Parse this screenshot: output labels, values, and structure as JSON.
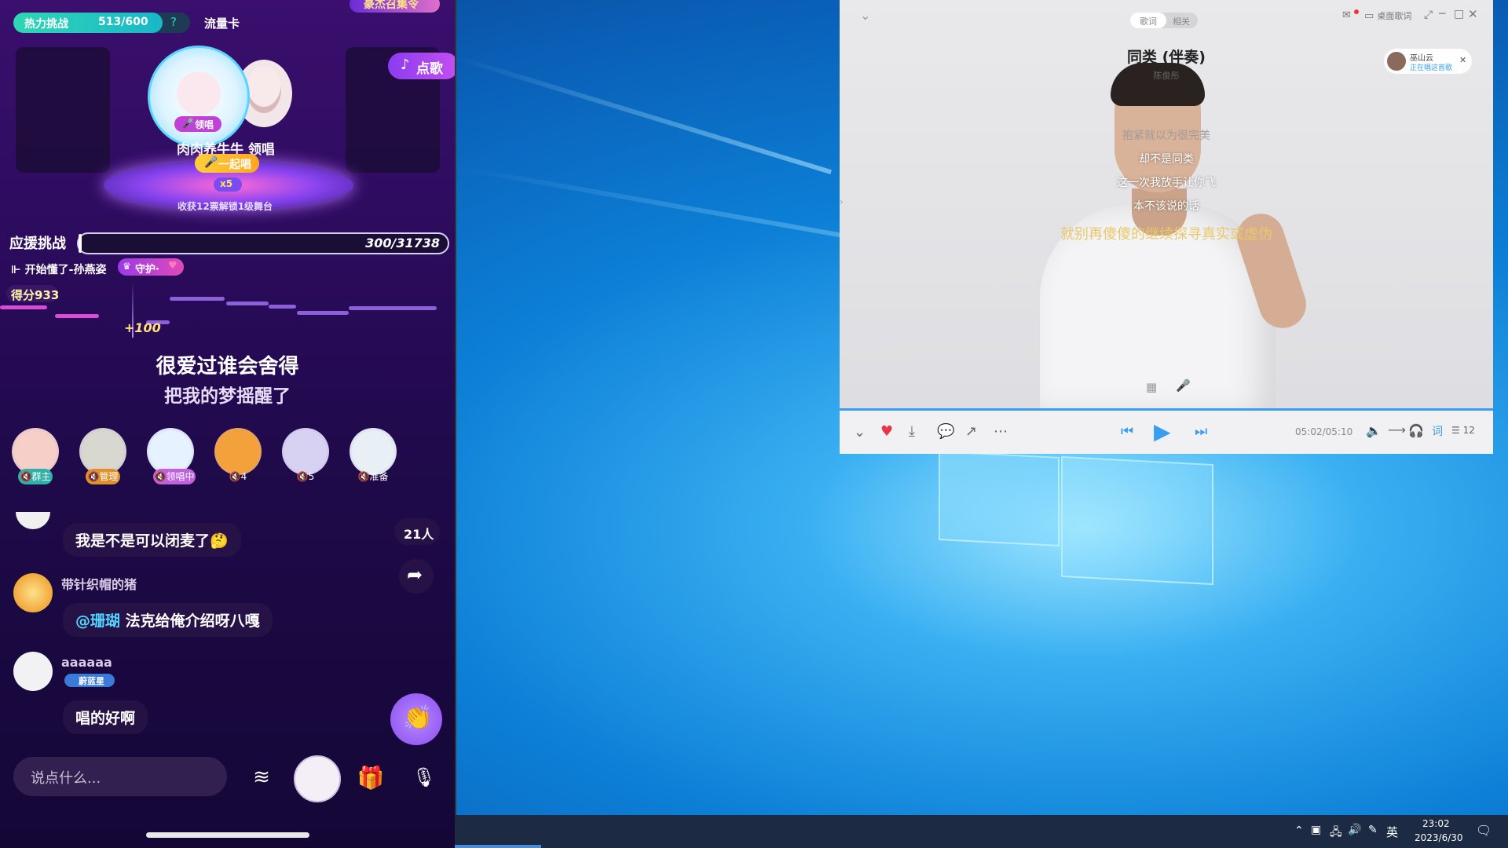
{
  "phone": {
    "challenge_label": "热力挑战",
    "challenge_progress": "513/600",
    "traffic_card": "流量卡",
    "top_banner": "豪杰召集令",
    "order_song": "点歌",
    "lead_badge": "领唱",
    "singer_line": "肉肉养牛牛 领唱",
    "sing_together": "一起唱",
    "gift_multiplier": "x5",
    "stage_caption": "收获12票解锁1级舞台",
    "support_label": "应援挑战",
    "support_progress": "300/31738",
    "support_fraction": 0.0095,
    "song_label": "开始懂了-孙燕姿",
    "guard_label": "守护·",
    "score_label": "得分933",
    "plus_score": "+100",
    "lyric_line1": "很爱过谁会舍得",
    "lyric_line2": "把我的梦摇醒了",
    "seats": [
      {
        "tag": "群主",
        "color": "#2fb0a8"
      },
      {
        "tag": "管理",
        "color": "#e0902c"
      },
      {
        "tag": "领唱中",
        "color": "#c062e0"
      },
      {
        "tag": "4",
        "color": "#00000000"
      },
      {
        "tag": "5",
        "color": "#00000000"
      },
      {
        "tag": "准备",
        "color": "#00000000"
      }
    ],
    "online_count": "21人",
    "chat": [
      {
        "name": "",
        "text": "我是不是可以闭麦了🤔"
      },
      {
        "name": "带针织帽的猪",
        "text": "@珊瑚 法克给俺介绍呀八嘎",
        "mention": "@珊瑚"
      },
      {
        "name": "aaaaaa",
        "badge": "蔚蓝星",
        "text": "唱的好啊"
      }
    ],
    "input_placeholder": "说点什么..."
  },
  "player": {
    "tab_lyrics": "歌词",
    "tab_related": "相关",
    "desktop_lyrics": "桌面歌词",
    "song_title": "同类 (伴奏)",
    "artist": "陈俊彤",
    "listener_name": "巫山云",
    "listener_status": "正在唱这首歌",
    "lyrics": [
      {
        "text": "抱紧就以为很完美",
        "state": "past"
      },
      {
        "text": "却不是同类",
        "state": "normal"
      },
      {
        "text": "这一次我放手让你飞",
        "state": "normal"
      },
      {
        "text": "本不该说的话",
        "state": "normal"
      },
      {
        "text": "就别再傻傻的继续探寻真实或虚伪",
        "state": "current"
      }
    ],
    "time": "05:02/05:10",
    "progress_fraction": 0.974,
    "queue_count": "12",
    "accent_color": "#3a9df0"
  },
  "taskbar": {
    "ime": "英",
    "time": "23:02",
    "date": "2023/6/30"
  }
}
